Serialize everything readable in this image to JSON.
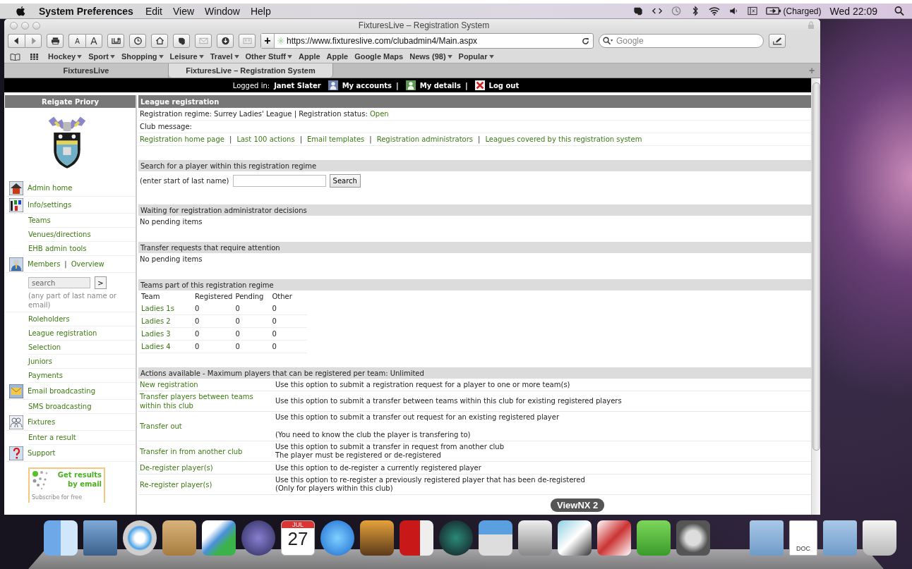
{
  "menu_bar": {
    "app_name": "System Preferences",
    "menus": [
      "Edit",
      "View",
      "Window",
      "Help"
    ],
    "battery_status": "(Charged)",
    "clock": "Wed 22:09"
  },
  "browser": {
    "title": "FixturesLive – Registration System",
    "text_smaller": "A",
    "text_bigger": "A",
    "add_button": "+",
    "address": "https://www.fixtureslive.com/clubadmin4/Main.aspx",
    "search_placeholder": "Google",
    "bookmarks": [
      {
        "label": "Hockey",
        "menu": true
      },
      {
        "label": "Sport",
        "menu": true
      },
      {
        "label": "Shopping",
        "menu": true
      },
      {
        "label": "Leisure",
        "menu": true
      },
      {
        "label": "Travel",
        "menu": true
      },
      {
        "label": "Other Stuff",
        "menu": true
      },
      {
        "label": "Apple",
        "menu": false
      },
      {
        "label": "Apple",
        "menu": false
      },
      {
        "label": "Google Maps",
        "menu": false
      },
      {
        "label": "News (98)",
        "menu": true
      },
      {
        "label": "Popular",
        "menu": true
      }
    ],
    "tabs": [
      {
        "label": "FixturesLive",
        "selected": false
      },
      {
        "label": "FixturesLive – Registration System",
        "selected": true
      }
    ],
    "new_tab": "+"
  },
  "top_bar": {
    "logged_in_label": "Logged in:",
    "user": "Janet Slater",
    "links": [
      {
        "label": "My accounts"
      },
      {
        "separator": "|",
        "label": "My details"
      },
      {
        "separator": "|",
        "label": "Log out"
      }
    ]
  },
  "sidebar": {
    "club_name": "Reigate Priory",
    "items": [
      {
        "kind": "main",
        "label": "Admin home"
      },
      {
        "kind": "main",
        "label": "Info/settings"
      },
      {
        "kind": "sub",
        "label": "Teams"
      },
      {
        "kind": "sub",
        "label": "Venues/directions"
      },
      {
        "kind": "sub",
        "label": "EHB admin tools"
      },
      {
        "kind": "main",
        "label": "Members",
        "separator": "|",
        "extra_label": "Overview"
      },
      {
        "kind": "search",
        "placeholder": "search",
        "button": ">",
        "hint": "(any part of last name or email)"
      },
      {
        "kind": "sub",
        "label": "Roleholders"
      },
      {
        "kind": "sub",
        "label": "League registration"
      },
      {
        "kind": "sub",
        "label": "Selection"
      },
      {
        "kind": "sub",
        "label": "Juniors"
      },
      {
        "kind": "sub",
        "label": "Payments"
      },
      {
        "kind": "main",
        "label": "Email broadcasting"
      },
      {
        "kind": "sub",
        "label": "SMS broadcasting"
      },
      {
        "kind": "main",
        "label": "Fixtures"
      },
      {
        "kind": "sub",
        "label": "Enter a result"
      },
      {
        "kind": "main",
        "label": "Support"
      }
    ],
    "promo": {
      "headline": "Get results by email",
      "subtitle": "Subscribe for free"
    }
  },
  "main": {
    "heading": "League registration",
    "regime": {
      "text": "Registration regime: Surrey Ladies' League | Registration status:",
      "status": "Open"
    },
    "club_message": "Club message:",
    "links": [
      {
        "label": "Registration home page"
      },
      {
        "separator": "|",
        "label": "Last 100 actions"
      },
      {
        "separator": "|",
        "label": "Email templates"
      },
      {
        "separator": "|",
        "label": "Registration administrators"
      },
      {
        "separator": "|",
        "label": "Leagues covered by this registration system"
      }
    ],
    "search_section": {
      "title": "Search for a player within this registration regime",
      "hint": "(enter start of last name)",
      "button": "Search"
    },
    "notices": [
      {
        "title": "Waiting for registration administrator decisions",
        "text": "No pending items"
      },
      {
        "title": "Transfer requests that require attention",
        "text": "No pending items"
      }
    ],
    "teams": {
      "title": "Teams part of this registration regime",
      "columns": [
        "Team",
        "Registered",
        "Pending",
        "Other"
      ],
      "rows": [
        [
          "Ladies 1s",
          "0",
          "0",
          "0"
        ],
        [
          "Ladies 2",
          "0",
          "0",
          "0"
        ],
        [
          "Ladies 3",
          "0",
          "0",
          "0"
        ],
        [
          "Ladies 4",
          "0",
          "0",
          "0"
        ]
      ]
    },
    "actions": {
      "title": "Actions available - Maximum players that can be registered per team: Unlimited",
      "rows": [
        {
          "label": "New registration",
          "description": [
            [
              "Use this option to submit a registration request for a player to one or more team(s)"
            ]
          ]
        },
        {
          "label": "Transfer players between teams within this club",
          "description": [
            [
              "Use this option to submit a transfer between teams within this club for existing registered players"
            ]
          ]
        },
        {
          "label": "Transfer out",
          "description": [
            [
              "Use this option to submit a transfer out request for an existing registered player"
            ],
            [
              "(You need to know the club the player is transfering to)"
            ]
          ]
        },
        {
          "label": "Transfer in from another club",
          "description": [
            [
              "Use this option to submit a transfer in request from another club",
              "The player must be registered or de-registered"
            ]
          ]
        },
        {
          "label": "De-register player(s)",
          "description": [
            [
              "Use this option to de-register a currently registered player"
            ]
          ]
        },
        {
          "label": "Re-register player(s)",
          "description": [
            [
              "Use this option to re-register a previously registered player that has been de-registered",
              "(Only for players within this club)"
            ]
          ]
        }
      ]
    }
  },
  "dock": {
    "tooltip": "ViewNX 2",
    "calendar": {
      "month": "JUL",
      "day": "27"
    },
    "document_label": "DOC"
  }
}
